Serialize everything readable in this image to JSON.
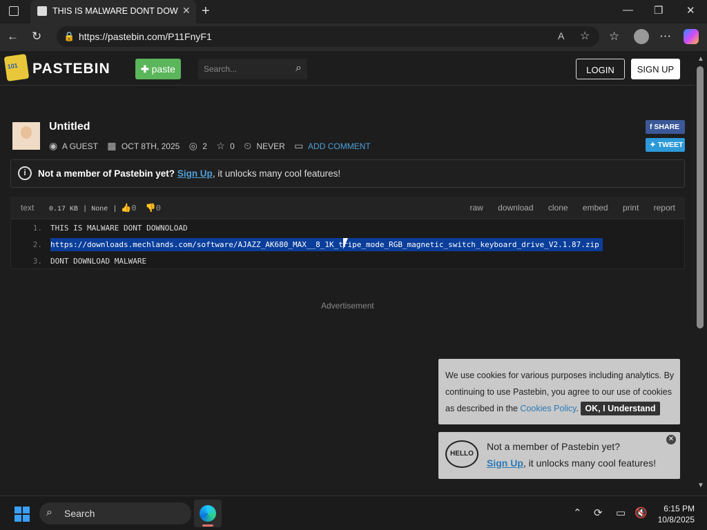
{
  "browser": {
    "tab_title": "THIS IS MALWARE DONT DOWNLOAD",
    "tab_close": "✕",
    "new_tab": "+",
    "url": "https://pastebin.com/P11FnyF1",
    "window_controls": [
      "—",
      "❐",
      "✕"
    ]
  },
  "header": {
    "logo_text": "101",
    "brand": "PASTEBIN",
    "paste_button": "paste",
    "search_placeholder": "Search...",
    "login": "LOGIN",
    "signup": "SIGN UP"
  },
  "paste": {
    "title": "Untitled",
    "author": "A GUEST",
    "date": "OCT 8TH, 2025",
    "views": "2",
    "stars": "0",
    "expires": "NEVER",
    "add_comment": "ADD COMMENT",
    "share": "SHARE",
    "tweet": "TWEET"
  },
  "notice": {
    "bold": "Not a member of Pastebin yet?",
    "link": "Sign Up",
    "rest": ", it unlocks many cool features!"
  },
  "codebar": {
    "syntax": "text",
    "size": "0.17 KB",
    "category": "None",
    "likes": "0",
    "dislikes": "0",
    "actions": [
      "raw",
      "download",
      "clone",
      "embed",
      "print",
      "report"
    ]
  },
  "code_lines": [
    {
      "num": "1.",
      "text": "THIS IS MALWARE DONT DOWNOLOAD"
    },
    {
      "num": "2.",
      "text": "https://downloads.mechlands.com/software/AJAZZ_AK680_MAX__8_1K_tripe_mode_RGB_magnetic_switch_keyboard_drive_V2.1.87.zip"
    },
    {
      "num": "3.",
      "text": "DONT DOWNLOAD MALWARE"
    }
  ],
  "advertisement": "Advertisement",
  "cookie": {
    "text1": "We use cookies for various purposes including analytics. By continuing to use Pastebin, you agree to our use of cookies as described in the ",
    "link": "Cookies Policy",
    "text2": ". ",
    "ok": "OK, I Understand"
  },
  "promo": {
    "hello": "HELLO",
    "line1": "Not a member of Pastebin yet?",
    "link": "Sign Up",
    "line2_rest": ", it unlocks many cool features!",
    "close": "✕"
  },
  "taskbar": {
    "search": "Search",
    "time": "6:15 PM",
    "date": "10/8/2025"
  }
}
